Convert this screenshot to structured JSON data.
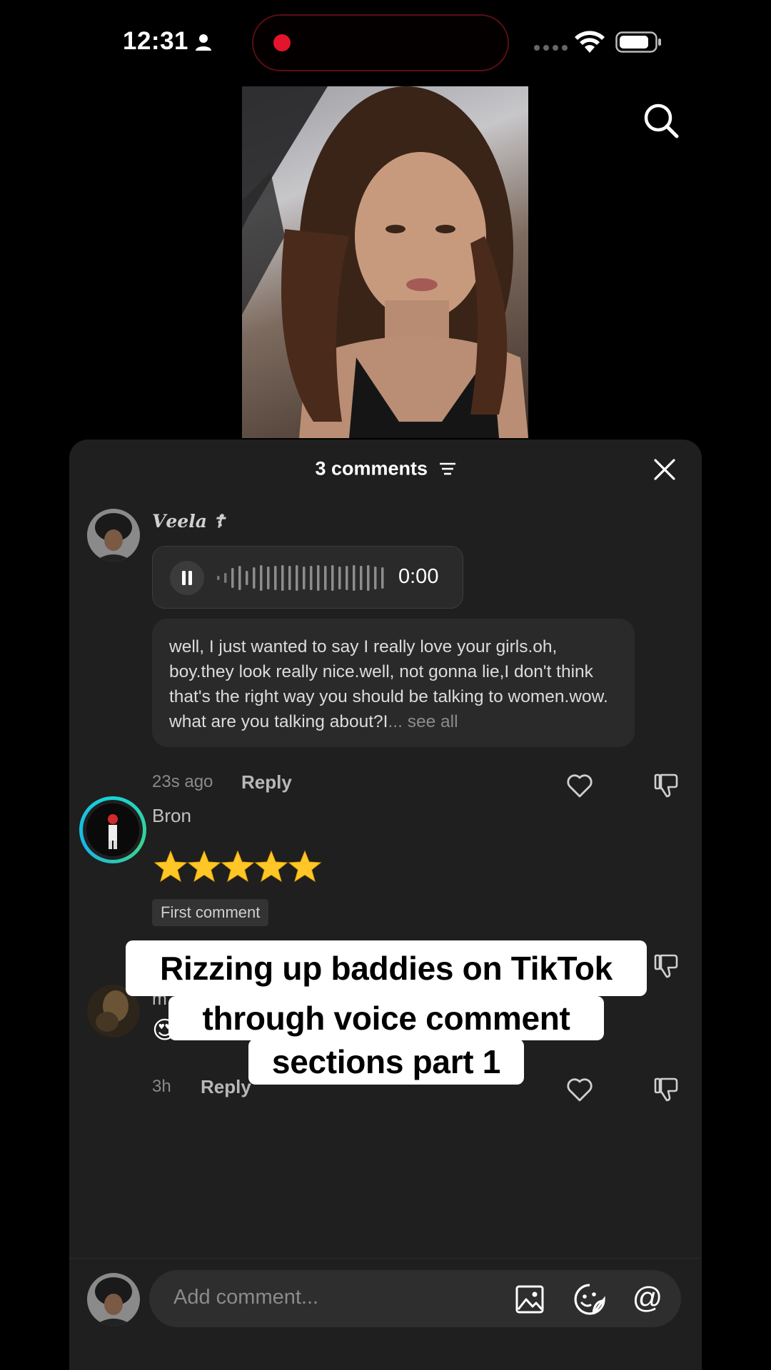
{
  "status_bar": {
    "time": "12:31"
  },
  "comments_sheet": {
    "header": {
      "title": "3 comments"
    },
    "comments": [
      {
        "username": "𝑽𝒆𝒆𝒍𝒂 ☦︎",
        "voice": {
          "duration": "0:00"
        },
        "transcript": "well, I just wanted to say I really love your girls.oh, boy.they look really nice.well, not gonna lie,I don't think that's the right way you should be talking to women.wow. what are you talking about?I",
        "see_all": "... see all",
        "time": "23s ago",
        "reply_label": "Reply"
      },
      {
        "username": "Bron",
        "content_emoji": "⭐⭐⭐⭐⭐",
        "badge": "First comment"
      },
      {
        "username": "m",
        "content_emoji": "😍😍",
        "time": "3h",
        "reply_label": "Reply"
      }
    ],
    "input": {
      "placeholder": "Add comment..."
    }
  },
  "overlay_caption": {
    "line1": "Rizzing up baddies on TikTok",
    "line2": "through voice comment",
    "line3": "sections part 1"
  }
}
